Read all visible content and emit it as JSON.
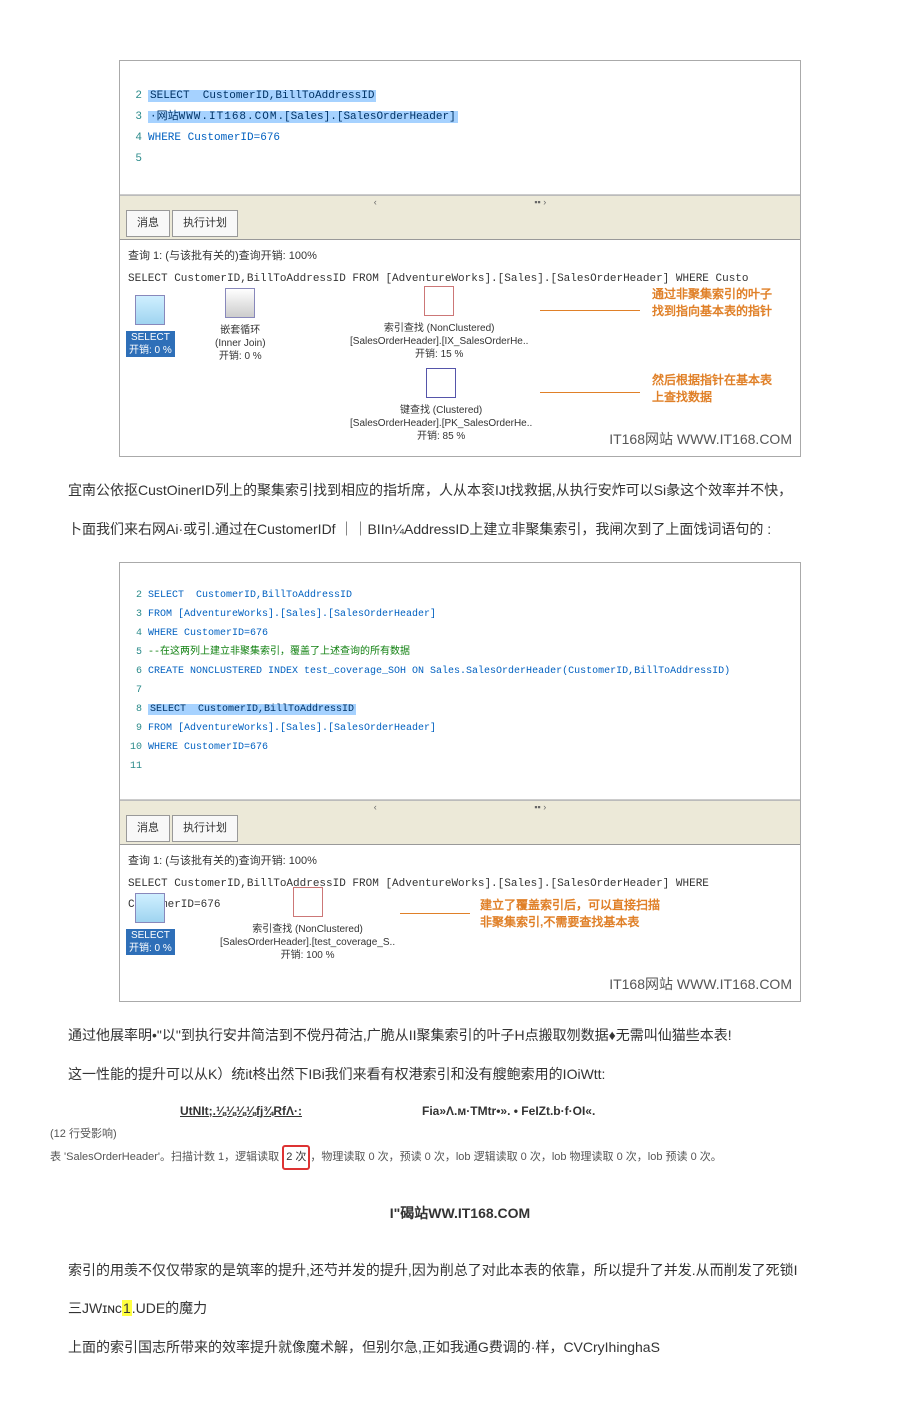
{
  "shot1": {
    "code": {
      "l2": "SELECT  CustomerID,BillToAddressID",
      "l3a": "·网站",
      "l3b": "WWW.IT168.COM",
      "l3c": ".[Sales].[SalesOrderHeader]",
      "l4": "WHERE CustomerID=676"
    },
    "tabs": {
      "a": "消息",
      "b": "执行计划"
    },
    "plan_title": "查询 1: (与该批有关的)查询开销: 100%",
    "plan_sql": "SELECT CustomerID,BillToAddressID FROM [AdventureWorks].[Sales].[SalesOrderHeader] WHERE Custo",
    "node_select": {
      "t1": "SELECT",
      "t2": "开销: 0 %"
    },
    "node_join": {
      "t1": "嵌套循环",
      "t2": "(Inner Join)",
      "t3": "开销: 0 %"
    },
    "node_seek": {
      "t1": "索引查找 (NonClustered)",
      "t2": "[SalesOrderHeader].[IX_SalesOrderHe..",
      "t3": "开销: 15 %"
    },
    "node_key": {
      "t1": "键查找 (Clustered)",
      "t2": "[SalesOrderHeader].[PK_SalesOrderHe..",
      "t3": "开销: 85 %"
    },
    "anno1": "通过非聚集索引的叶子找到指向基本表的指针",
    "anno2": "然后根据指针在基本表上查找数据",
    "watermark": "IT168网站  WWW.IT168.COM"
  },
  "para1": "宜南公依抠CustOinerID列上的聚集索引找到相应的指圻席，人从本衮IJt找救据,从执行安炸可以Si彖这个效率并不快，",
  "para2": "卜面我们来右网Ai·或引.通过在CustomerIDf ｜｜BIIn¼AddressID上建立非聚集索引，我闸次到了上面饯词语句的                       :",
  "shot2": {
    "code": {
      "l2": "SELECT  CustomerID,BillToAddressID",
      "l3": "FROM [AdventureWorks].[Sales].[SalesOrderHeader]",
      "l4": "WHERE CustomerID=676",
      "l5": "--在这两列上建立非聚集索引，覆盖了上述查询的所有数据",
      "l6": "CREATE NONCLUSTERED INDEX test_coverage_SOH ON Sales.SalesOrderHeader(CustomerID,BillToAddressID)",
      "l8": "SELECT  CustomerID,BillToAddressID",
      "l9": "FROM [AdventureWorks].[Sales].[SalesOrderHeader]",
      "l10": "WHERE CustomerID=676"
    },
    "tabs": {
      "a": "消息",
      "b": "执行计划"
    },
    "plan_title": "查询 1: (与该批有关的)查询开销: 100%",
    "plan_sql": "SELECT CustomerID,BillToAddressID FROM [AdventureWorks].[Sales].[SalesOrderHeader] WHERE CustomerID=676",
    "node_select": {
      "t1": "SELECT",
      "t2": "开销: 0 %"
    },
    "node_seek": {
      "t1": "索引查找 (NonClustered)",
      "t2": "[SalesOrderHeader].[test_coverage_S..",
      "t3": "开销: 100 %"
    },
    "anno1": "建立了覆盖索引后，可以直接扫描非聚集索引,不需要查找基本表",
    "watermark": "IT168网站  WWW.IT168.COM"
  },
  "para3": "通过他展率明•\"以\"到执行安井简洁到不傥丹荷沽,广脆从II聚集索引的叶子H点搬取刎数据♦无需叫仙猫些本表!",
  "para4": "这一性能的提升可以从K）统it柊出然下IBi我们来看有权港索引和没有艘鲍索用的IOiWtt:",
  "compare": {
    "left_label": "UtNIt;.⅛⅛⅛⅛fj¾RfΛ·:",
    "right_label": "Fia»Λ.м·TMtr•». • FeIZt.b·f·OI«."
  },
  "io_line1": "(12 行受影响)",
  "io_line2_a": "表 'SalesOrderHeader'。扫描计数 1，逻辑读取 ",
  "io_line2_red": "2 次",
  "io_line2_b": "，物理读取 0 次，预读 0 次，lob 逻辑读取 0 次，lob 物理读取 0 次，lob 预读 0 次。",
  "center": "I\"碣站WW.IT168.COM",
  "para5": "索引的用羡不仅仅带家的是筑率的提升,还芍并发的提升,因为削总了对此本表的依靠，所以提升了并发.从而削发了死锁I",
  "heading3": {
    "pre": "三JWɪɴᴄ",
    "hl": "1",
    "post": ".UDE的魔力"
  },
  "para6": "上面的索引国志所带来的效率提升就像魔术解，但别尔急,正如我通G费调的·样，CVCryIhinghaS"
}
